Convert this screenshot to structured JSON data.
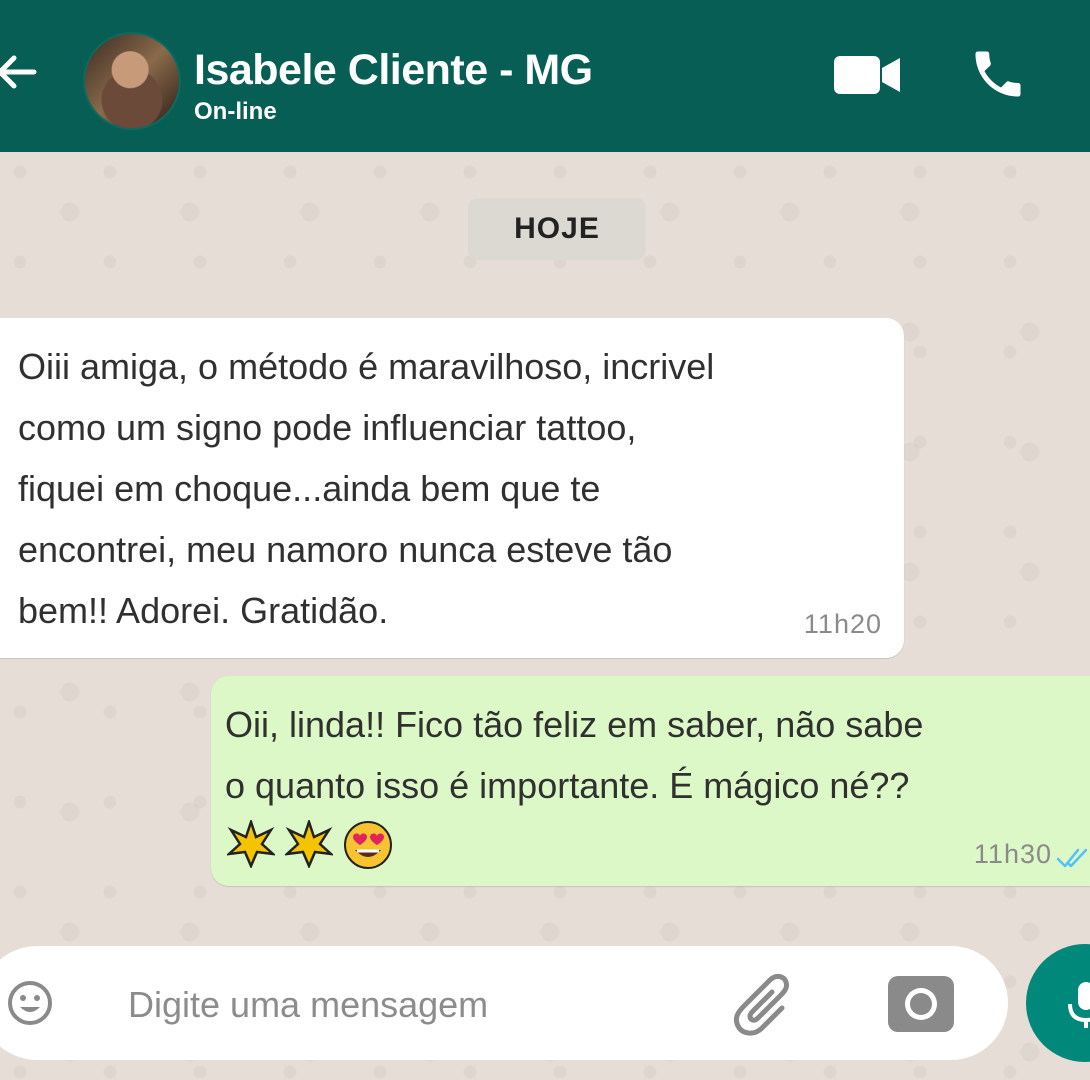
{
  "header": {
    "contact_name": "Isabele Cliente - MG",
    "status": "On-line",
    "icons": [
      "back-arrow-icon",
      "video-call-icon",
      "phone-icon"
    ],
    "color": "#075e54"
  },
  "chat": {
    "date_label": "HOJE",
    "messages": [
      {
        "direction": "incoming",
        "text": "Oiii amiga, o método é maravilhoso, incrivel\ncomo um signo pode influenciar tattoo,\nfiquei em choque...ainda bem que te\nencontrei, meu namoro nunca esteve tão\nbem!! Adorei. Gratidão.",
        "time": "11h20",
        "bubble_color": "#ffffff"
      },
      {
        "direction": "outgoing",
        "text": "Oii, linda!! Fico tão feliz em saber, não sabe\no quanto isso é importante. É mágico né??",
        "emojis": [
          "sparkle-star-icon",
          "sparkle-star-icon",
          "heart-eyes-emoji-icon"
        ],
        "time": "11h30",
        "status": "read",
        "bubble_color": "#dcf8c6"
      }
    ]
  },
  "composer": {
    "placeholder": "Digite uma mensagem",
    "value": "",
    "icons": [
      "emoji-icon",
      "attach-icon",
      "camera-icon",
      "microphone-icon"
    ],
    "mic_color": "#00897b"
  }
}
